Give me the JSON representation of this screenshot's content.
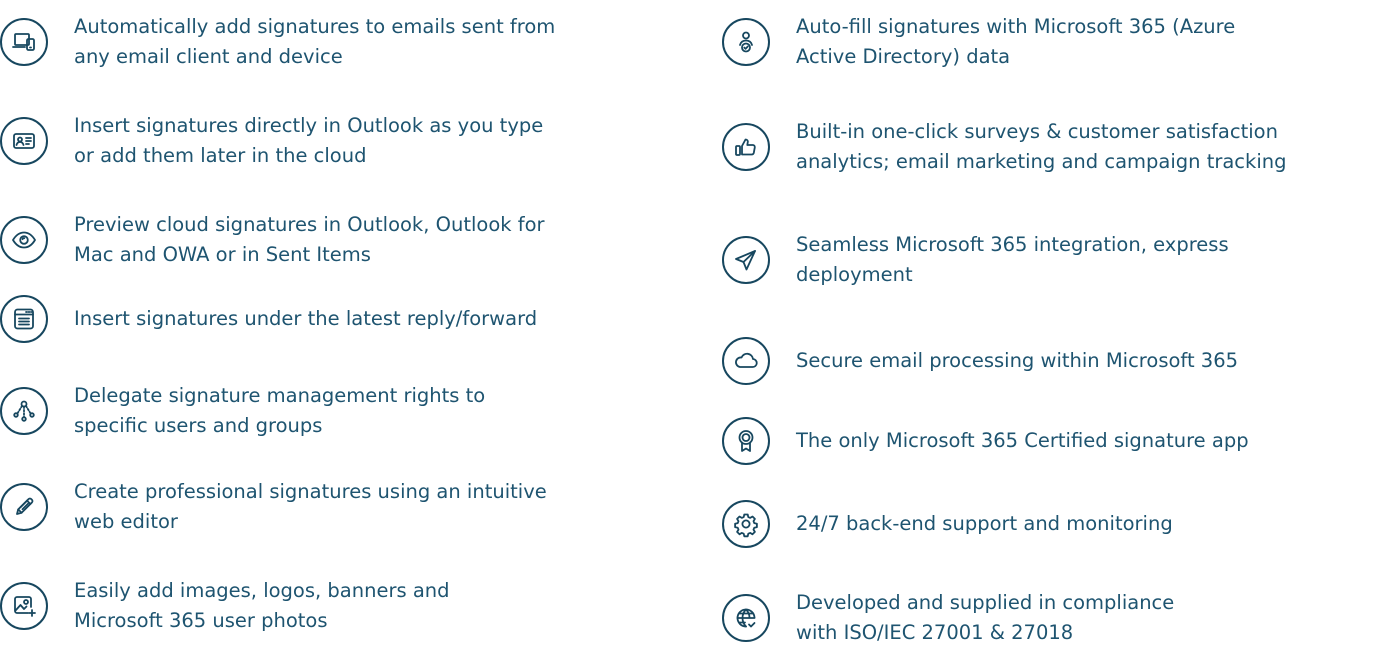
{
  "features_left": [
    {
      "icon": "devices-icon",
      "text": "Automatically add signatures to emails sent from\nany email client and device"
    },
    {
      "icon": "id-card-icon",
      "text": "Insert signatures directly in Outlook as you type\nor add them later in the cloud"
    },
    {
      "icon": "eye-icon",
      "text": "Preview cloud signatures in Outlook, Outlook for\nMac and OWA or in Sent Items"
    },
    {
      "icon": "window-icon",
      "text": "Insert signatures under the latest reply/forward"
    },
    {
      "icon": "network-icon",
      "text": "Delegate signature management rights to\nspecific users and groups"
    },
    {
      "icon": "pencil-icon",
      "text": "Create professional signatures using an intuitive\nweb editor"
    },
    {
      "icon": "add-image-icon",
      "text": "Easily add images, logos, banners and\nMicrosoft 365 user photos"
    }
  ],
  "features_right": [
    {
      "icon": "user-check-icon",
      "text": "Auto-fill signatures with Microsoft 365 (Azure\nActive Directory) data"
    },
    {
      "icon": "thumbs-up-icon",
      "text": "Built-in one-click surveys & customer satisfaction\nanalytics; email marketing and campaign tracking"
    },
    {
      "icon": "paper-plane-icon",
      "text": "Seamless Microsoft 365 integration, express\ndeployment"
    },
    {
      "icon": "cloud-icon",
      "text": "Secure email processing within Microsoft 365"
    },
    {
      "icon": "award-icon",
      "text": "The only Microsoft 365 Certified signature app"
    },
    {
      "icon": "gear-icon",
      "text": "24/7 back-end support and monitoring"
    },
    {
      "icon": "globe-check-icon",
      "text": "Developed and supplied in compliance\nwith ISO/IEC 27001 & 27018"
    }
  ]
}
